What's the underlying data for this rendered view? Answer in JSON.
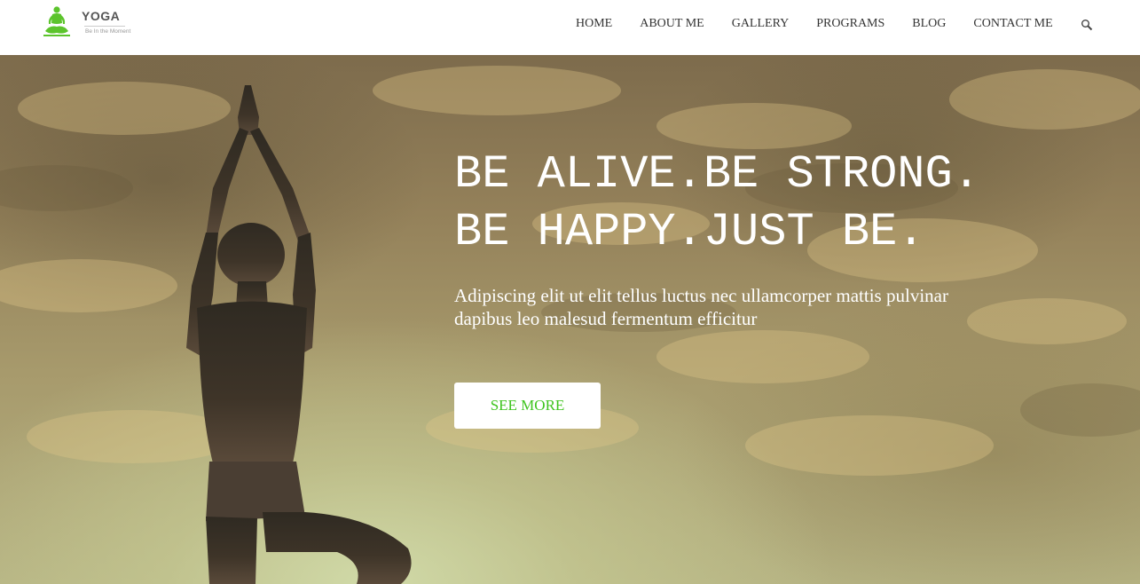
{
  "logo": {
    "name": "YOGA",
    "tagline": "Be In the Moment",
    "color": "#5cc42c"
  },
  "nav": {
    "items": [
      {
        "label": "HOME"
      },
      {
        "label": "ABOUT ME"
      },
      {
        "label": "GALLERY"
      },
      {
        "label": "PROGRAMS"
      },
      {
        "label": "BLOG"
      },
      {
        "label": "CONTACT ME"
      }
    ],
    "search_icon": "search-icon"
  },
  "hero": {
    "title_line1": "BE ALIVE.BE STRONG.",
    "title_line2": "BE HAPPY.JUST BE.",
    "subtitle": "Adipiscing elit ut elit tellus luctus nec ullamcorper mattis pulvinar dapibus leo malesud fermentum efficitur",
    "button_label": "SEE MORE",
    "button_text_color": "#3fc41e"
  }
}
